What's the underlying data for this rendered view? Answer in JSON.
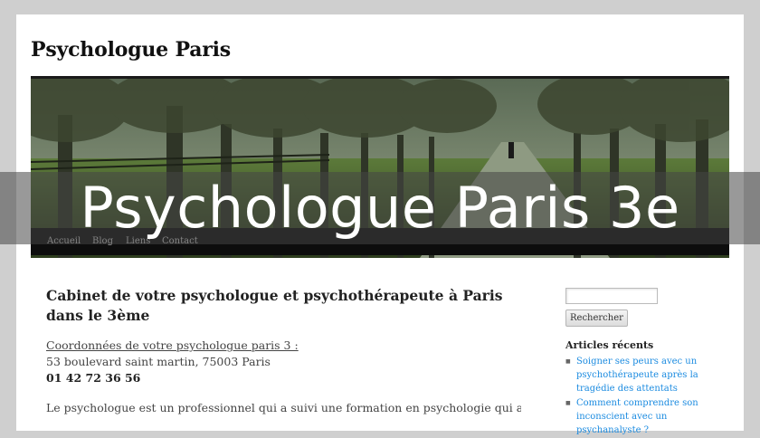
{
  "site": {
    "title": "Psychologue Paris"
  },
  "nav": {
    "items": [
      "Accueil",
      "Blog",
      "Liens",
      "Contact"
    ]
  },
  "overlay": {
    "title": "Psychologue Paris 3e"
  },
  "article": {
    "heading": "Cabinet de votre psychologue et psychothérapeute à Paris dans le 3ème",
    "contact_link": "Coordonnées de votre psychologue paris 3 :",
    "address": "53 boulevard saint martin, 75003 Paris",
    "phone": "01 42 72 36 56",
    "intro": "Le psychologue est un professionnel qui a suivi une formation en psychologie qui a une"
  },
  "sidebar": {
    "search_button": "Rechercher",
    "recent_title": "Articles récents",
    "recent_posts": [
      "Soigner ses peurs avec un psychothérapeute après la tragédie des attentats",
      "Comment comprendre son inconscient avec un psychanalyste ?"
    ]
  },
  "colors": {
    "background": "#cfcfcf",
    "navbar": "#0d0d0d",
    "link": "#1b8be0"
  }
}
